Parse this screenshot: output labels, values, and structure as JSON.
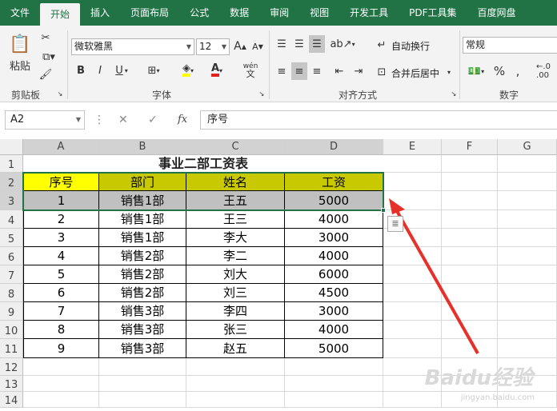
{
  "tabs": [
    "文件",
    "开始",
    "插入",
    "页面布局",
    "公式",
    "数据",
    "审阅",
    "视图",
    "开发工具",
    "PDF工具集",
    "百度网盘"
  ],
  "active_tab": "开始",
  "ribbon": {
    "clipboard": {
      "paste": "粘贴",
      "label": "剪贴板"
    },
    "font": {
      "name": "微软雅黑",
      "size": "12",
      "bold": "B",
      "italic": "I",
      "underline": "U",
      "label": "字体",
      "wen": "wén",
      "wen2": "文"
    },
    "alignment": {
      "wrap": "自动换行",
      "merge": "合并后居中",
      "label": "对齐方式"
    },
    "number": {
      "format": "常规",
      "label": "数字"
    }
  },
  "formula_bar": {
    "name_box": "A2",
    "fx": "fx",
    "content": "序号"
  },
  "sheet": {
    "columns": [
      "A",
      "B",
      "C",
      "D",
      "E",
      "F",
      "G"
    ],
    "rows": [
      "1",
      "2",
      "3",
      "4",
      "5",
      "6",
      "7",
      "8",
      "9",
      "10",
      "11",
      "12",
      "13",
      "14"
    ],
    "title": "事业二部工资表",
    "headers": [
      "序号",
      "部门",
      "姓名",
      "工资"
    ],
    "data": [
      [
        "1",
        "销售1部",
        "王五",
        "5000"
      ],
      [
        "2",
        "销售1部",
        "王三",
        "4000"
      ],
      [
        "3",
        "销售1部",
        "李大",
        "3000"
      ],
      [
        "4",
        "销售2部",
        "李二",
        "4000"
      ],
      [
        "5",
        "销售2部",
        "刘大",
        "6000"
      ],
      [
        "6",
        "销售2部",
        "刘三",
        "4500"
      ],
      [
        "7",
        "销售3部",
        "李四",
        "3000"
      ],
      [
        "8",
        "销售3部",
        "张三",
        "4000"
      ],
      [
        "9",
        "销售3部",
        "赵五",
        "5000"
      ]
    ]
  },
  "colors": {
    "header_yellow": "#ffff00",
    "header_olive": "#c9c900",
    "selected_row": "#c0c0c0",
    "excel_green": "#217346",
    "arrow": "#e8302a"
  },
  "watermark": {
    "text": "Baidu经验",
    "url": "jingyan.baidu.com"
  }
}
